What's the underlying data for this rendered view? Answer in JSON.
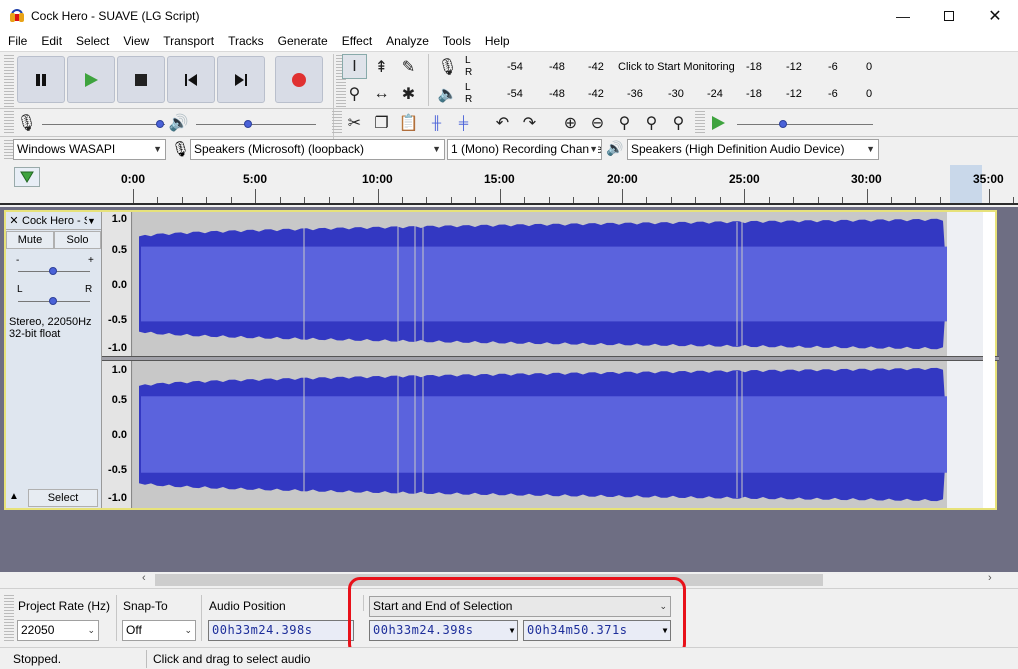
{
  "window": {
    "title": "Cock Hero - SUAVE (LG Script)",
    "minimize_icon": "minimize-icon",
    "maximize_icon": "maximize-icon",
    "close_icon": "close-icon"
  },
  "menu": [
    "File",
    "Edit",
    "Select",
    "View",
    "Transport",
    "Tracks",
    "Generate",
    "Effect",
    "Analyze",
    "Tools",
    "Help"
  ],
  "meters": {
    "record_ticks": [
      "-54",
      "-48",
      "-42",
      "-18",
      "-12",
      "-6",
      "0"
    ],
    "record_click_text": "Click to Start Monitoring",
    "play_ticks": [
      "-54",
      "-48",
      "-42",
      "-36",
      "-30",
      "-24",
      "-18",
      "-12",
      "-6",
      "0"
    ],
    "lr": [
      "L",
      "R"
    ]
  },
  "devices": {
    "host": "Windows WASAPI",
    "recording_device": "Speakers (Microsoft) (loopback)",
    "channels": "1 (Mono) Recording Channel",
    "playback_device": "Speakers (High Definition Audio Device)"
  },
  "ruler": {
    "labels": [
      "0:00",
      "5:00",
      "10:00",
      "15:00",
      "20:00",
      "25:00",
      "30:00",
      "35:00"
    ]
  },
  "track": {
    "name": "Cock Hero - SUAVE",
    "mute_label": "Mute",
    "solo_label": "Solo",
    "gain_minus": "-",
    "gain_plus": "+",
    "pan_left": "L",
    "pan_right": "R",
    "format_line1": "Stereo, 22050Hz",
    "format_line2": "32-bit float",
    "select_label": "Select",
    "scale_labels": [
      "1.0",
      "0.5",
      "0.0",
      "-0.5",
      "-1.0"
    ],
    "wave_color": "#5b63dd",
    "wave_dark_color": "#3338c2"
  },
  "selection_toolbar": {
    "project_rate_label": "Project Rate (Hz)",
    "project_rate_value": "22050",
    "snap_to_label": "Snap-To",
    "snap_to_value": "Off",
    "audio_position_label": "Audio Position",
    "audio_position_value": "00h33m24.398s",
    "selection_mode": "Start and End of Selection",
    "selection_start": "00h33m24.398s",
    "selection_end": "00h34m50.371s",
    "highlight_color": "#e8111a"
  },
  "status": {
    "state": "Stopped.",
    "hint": "Click and drag to select audio"
  }
}
